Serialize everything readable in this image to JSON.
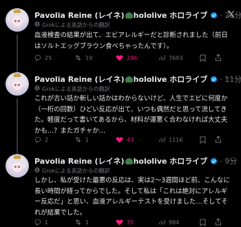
{
  "common": {
    "translated_label": "Grokによる英語からの翻訳",
    "icons": [
      "x-logo-icon",
      "verified-icon",
      "reply-icon",
      "retweet-icon",
      "heart-icon",
      "views-icon",
      "bookmark-icon",
      "share-icon",
      "more-icon",
      "globe-icon"
    ],
    "colors": {
      "background": "#000000",
      "text": "#e7e9ea",
      "muted": "#71767b",
      "like": "#f91880",
      "verified": "#1d9bf0",
      "heart_filled": "#f91880"
    }
  },
  "tweets": [
    {
      "name": "Pavolia Reine (レイネ)",
      "affiliation": "hololive ホロライブ",
      "time": "26分",
      "text": "血液検査の結果が出て、エビアレルギーだと診断されました（前日はソルトエッグブラウン食べちゃったんです）。",
      "replies": "25",
      "retweets": "19",
      "likes": "296",
      "views": "7693"
    },
    {
      "name": "Pavolia Reine (レイネ)",
      "affiliation": "hololive ホロライブ",
      "time": "11分",
      "text": "これが古い話か新しい話かはわからないけど、人生でエビに何度か（一桁の回数）ひどい反応が出て、いつも偶然だと思って流してきた。軽度だって書いてあるから、材料が運悪く合わなければ大丈夫かも…？またガチャか…",
      "replies": "2",
      "retweets": "1",
      "likes": "43",
      "views": "1116"
    },
    {
      "name": "Pavolia Reine (レイネ)",
      "affiliation": "hololive ホロライブ",
      "time": "9分",
      "text": "しかし、私が受けた最悪の反応は、実は2〜3週間ほど前、こんなに長い時間が経ってからでした。そして私は「これは絶対にアレルギー反応だ」と思い、血液アレルギーテストを受けました…そしてそれが結果でした。",
      "replies": "1",
      "retweets": "1",
      "likes": "35",
      "views": "984"
    }
  ]
}
